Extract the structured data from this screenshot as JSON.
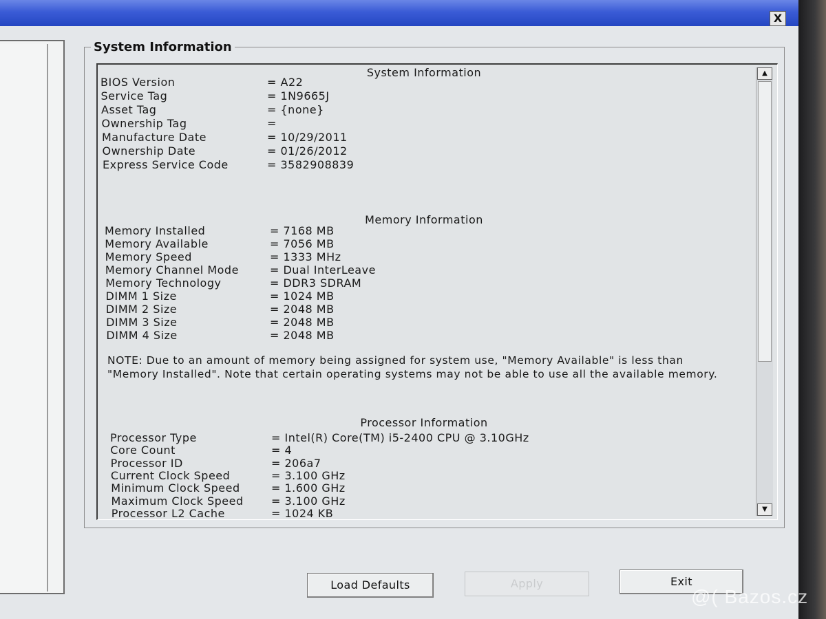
{
  "window": {
    "close_label": "X"
  },
  "group_title": "System Information",
  "sections": {
    "system": {
      "title": "System Information",
      "rows": [
        {
          "label": "BIOS Version",
          "value": "= A22"
        },
        {
          "label": "Service Tag",
          "value": "= 1N9665J"
        },
        {
          "label": "Asset Tag",
          "value": "= {none}"
        },
        {
          "label": "Ownership Tag",
          "value": "="
        },
        {
          "label": "Manufacture Date",
          "value": "= 10/29/2011"
        },
        {
          "label": "Ownership Date",
          "value": "= 01/26/2012"
        },
        {
          "label": "Express Service Code",
          "value": "= 3582908839"
        }
      ]
    },
    "memory": {
      "title": "Memory Information",
      "rows": [
        {
          "label": "Memory Installed",
          "value": "= 7168 MB"
        },
        {
          "label": "Memory Available",
          "value": "= 7056 MB"
        },
        {
          "label": "Memory Speed",
          "value": "= 1333 MHz"
        },
        {
          "label": "Memory Channel Mode",
          "value": "= Dual InterLeave"
        },
        {
          "label": "Memory Technology",
          "value": "= DDR3 SDRAM"
        },
        {
          "label": "DIMM 1 Size",
          "value": "= 1024 MB"
        },
        {
          "label": "DIMM 2 Size",
          "value": "= 2048 MB"
        },
        {
          "label": "DIMM 3 Size",
          "value": "= 2048 MB"
        },
        {
          "label": "DIMM 4 Size",
          "value": "= 2048 MB"
        }
      ],
      "note": "NOTE: Due to an amount of memory being assigned for system use, \"Memory Available\" is less than \"Memory Installed\". Note that certain operating systems may not be able to use all the available memory."
    },
    "processor": {
      "title": "Processor Information",
      "rows": [
        {
          "label": "Processor Type",
          "value": "= Intel(R) Core(TM) i5-2400 CPU @ 3.10GHz"
        },
        {
          "label": "Core Count",
          "value": "= 4"
        },
        {
          "label": "Processor ID",
          "value": "= 206a7"
        },
        {
          "label": "Current Clock Speed",
          "value": "= 3.100 GHz"
        },
        {
          "label": "Minimum Clock Speed",
          "value": "= 1.600 GHz"
        },
        {
          "label": "Maximum Clock Speed",
          "value": "= 3.100 GHz"
        },
        {
          "label": "Processor L2 Cache",
          "value": "= 1024 KB"
        }
      ]
    }
  },
  "scrollbar": {
    "up_glyph": "▲",
    "down_glyph": "▼"
  },
  "buttons": {
    "load_defaults": "Load Defaults",
    "apply": "Apply",
    "exit": "Exit"
  },
  "watermark": "@( Bazos.cz"
}
